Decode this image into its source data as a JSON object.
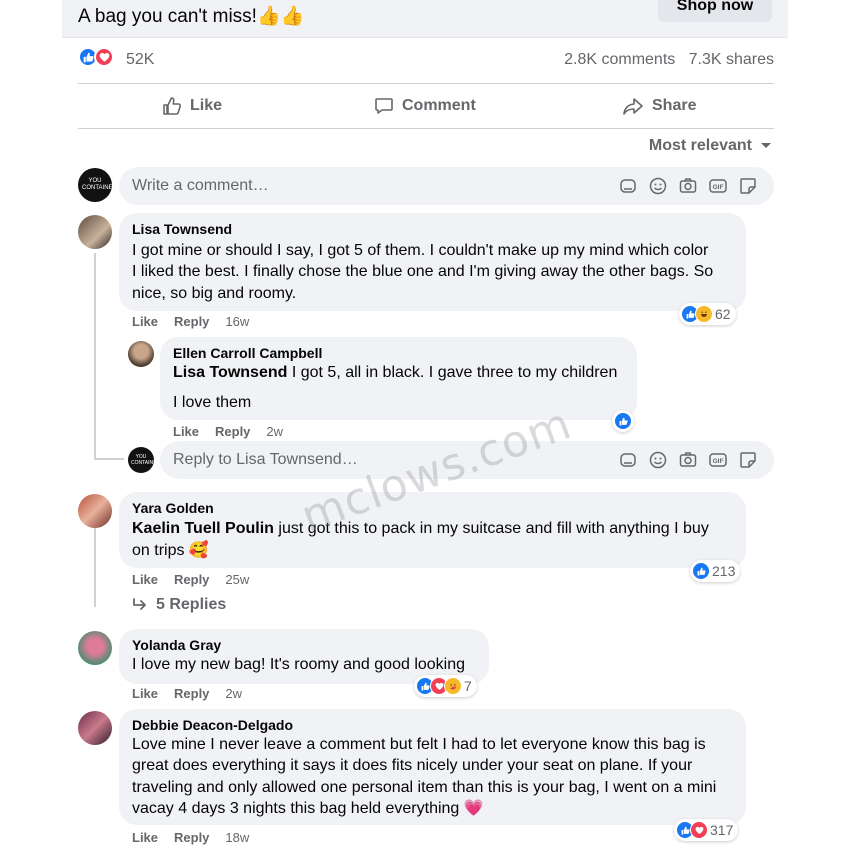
{
  "post": {
    "headline": "A bag you can't miss!👍👍",
    "shop_button": "Shop now",
    "reaction_count": "52K",
    "comments_count": "2.8K comments",
    "shares_count": "7.3K shares"
  },
  "actions": {
    "like": "Like",
    "comment": "Comment",
    "share": "Share"
  },
  "sort_label": "Most relevant",
  "write_comment_placeholder": "Write a comment…",
  "brand_avatar_text": "YOU CONTAINED",
  "comments": [
    {
      "author": "Lisa Townsend",
      "lines": [
        "I got mine or should I say, I got 5 of them. I couldn't make up my mind which color",
        "I liked the best. I finally chose the blue one and I'm giving away the other bags. So",
        "nice, so big and roomy."
      ],
      "like": "Like",
      "reply": "Reply",
      "time": "16w",
      "reaction_count": "62"
    },
    {
      "author": "Yara Golden",
      "mention": "Kaelin Tuell Poulin",
      "line1_rest": " just got this to pack in my suitcase and fill with anything I buy",
      "line2": "on trips 🥰",
      "like": "Like",
      "reply": "Reply",
      "time": "25w",
      "reaction_count": "213"
    },
    {
      "author": "Yolanda Gray",
      "text": "I love my new bag! It's roomy and good looking",
      "like": "Like",
      "reply": "Reply",
      "time": "2w",
      "reaction_count": "7"
    },
    {
      "author": "Debbie Deacon-Delgado",
      "lines": [
        "Love mine I never leave a comment but felt I had to let everyone know this bag is",
        "great does everything it says it does fits nicely under your seat on plane. If your",
        "traveling and only allowed one personal item than this is your bag, I went on a mini",
        "vacay 4 days 3 nights this bag held everything 💗"
      ],
      "like": "Like",
      "reply": "Reply",
      "time": "18w",
      "reaction_count": "317"
    }
  ],
  "reply": {
    "author": "Ellen Carroll Campbell",
    "mention": "Lisa Townsend",
    "line1_rest": " I got 5, all in black. I gave three to my children",
    "line2": "I love them",
    "like": "Like",
    "reply": "Reply",
    "time": "2w"
  },
  "reply_input_placeholder": "Reply to Lisa Townsend…",
  "view_replies": "5 Replies",
  "watermark": "mclows.com",
  "colors": {
    "like": "#1877f2",
    "love": "#f33e58",
    "haha": "#f7b928",
    "bubble": "#f0f2f5",
    "muted": "#65676b"
  }
}
